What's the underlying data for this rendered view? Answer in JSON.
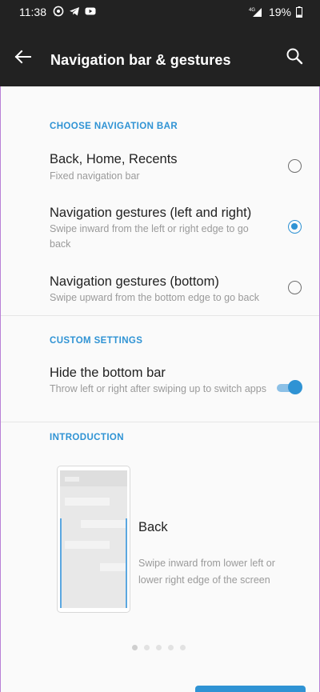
{
  "status_bar": {
    "time": "11:38",
    "left_icons": [
      "whatsapp-icon",
      "telegram-icon",
      "youtube-icon"
    ],
    "network": "4G",
    "battery": "19%"
  },
  "toolbar": {
    "title": "Navigation bar & gestures",
    "back_icon": "arrow-left-icon",
    "search_icon": "search-icon"
  },
  "sections": {
    "choose_nav": {
      "header": "CHOOSE NAVIGATION BAR",
      "options": [
        {
          "title": "Back, Home, Recents",
          "subtitle": "Fixed navigation bar",
          "selected": false
        },
        {
          "title": "Navigation gestures (left and right)",
          "subtitle": "Swipe inward from the left or right edge to go back",
          "selected": true
        },
        {
          "title": "Navigation gestures (bottom)",
          "subtitle": "Swipe upward from the bottom edge to go back",
          "selected": false
        }
      ]
    },
    "custom": {
      "header": "CUSTOM SETTINGS",
      "hide_bar": {
        "title": "Hide the bottom bar",
        "subtitle": "Throw left or right after swiping up to switch apps",
        "enabled": true
      }
    },
    "intro": {
      "header": "INTRODUCTION",
      "title": "Back",
      "description": "Swipe inward from lower left or lower right edge of the screen",
      "page_count": 5,
      "current_page": 1
    }
  },
  "colors": {
    "accent": "#2f93d4",
    "toolbar_bg": "#222222",
    "page_bg": "#fafafa"
  }
}
